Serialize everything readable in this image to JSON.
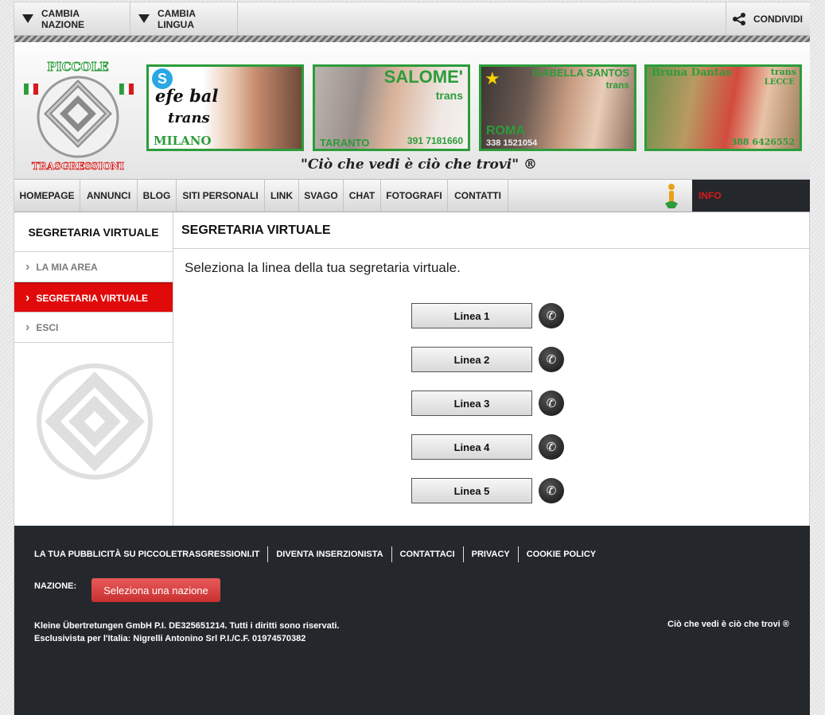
{
  "topbar": {
    "change_country": "CAMBIA NAZIONE",
    "change_language": "CAMBIA LINGUA",
    "share": "CONDIVIDI"
  },
  "header": {
    "logo_text_top": "PICCOLE",
    "logo_text_bottom": "TRASGRESSIONI",
    "tagline": "\"Ciò che vedi è ciò che trovi\" ®",
    "banners": [
      {
        "name": "efe bal",
        "subtitle": "trans",
        "city": "MILANO"
      },
      {
        "name": "SALOME'",
        "subtitle": "trans",
        "city": "TARANTO",
        "phone": "391 7181660"
      },
      {
        "name": "ISABELLA SANTOS",
        "subtitle": "trans",
        "city": "ROMA",
        "phone": "338 1521054"
      },
      {
        "name": "Bruna Dantas",
        "subtitle": "trans",
        "city": "LECCE",
        "phone": "388 6426552"
      }
    ]
  },
  "nav": {
    "items": [
      "HOMEPAGE",
      "ANNUNCI",
      "BLOG",
      "SITI PERSONALI",
      "LINK",
      "SVAGO",
      "CHAT",
      "FOTOGRAFI",
      "CONTATTI"
    ],
    "info": "INFO"
  },
  "sidebar": {
    "title": "SEGRETARIA VIRTUALE",
    "items": [
      "LA MIA AREA",
      "SEGRETARIA VIRTUALE",
      "ESCI"
    ]
  },
  "main": {
    "title": "SEGRETARIA VIRTUALE",
    "intro": "Seleziona la linea della tua segretaria virtuale.",
    "lines": [
      "Linea 1",
      "Linea 2",
      "Linea 3",
      "Linea 4",
      "Linea 5"
    ]
  },
  "footer": {
    "links": [
      "LA TUA PUBBLICITÀ SU PICCOLETRASGRESSIONI.IT",
      "DIVENTA INSERZIONISTA",
      "CONTATTACI",
      "PRIVACY",
      "COOKIE POLICY"
    ],
    "country_label": "NAZIONE:",
    "country_button": "Seleziona una nazione",
    "legal_line1": "Kleine Übertretungen GmbH  P.I. DE325651214.  Tutti i diritti sono riservati.",
    "legal_line2": "Esclusivista per l'Italia:  Nigrelli Antonino Srl  P.I./C.F. 01974570382",
    "slogan": "Ciò che vedi è ciò che trovi ®"
  },
  "colors": {
    "accent_red": "#e10a0a",
    "banner_green": "#2c9c3a",
    "footer_bg": "#24282c"
  }
}
